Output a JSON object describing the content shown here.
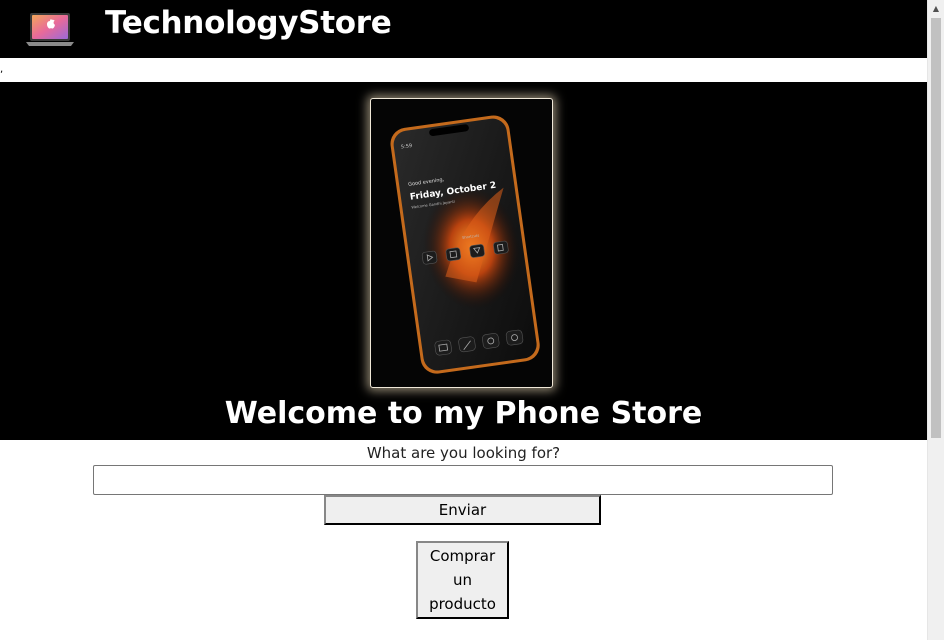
{
  "header": {
    "logo_icon": "laptop-logo-icon",
    "brand": "TechnologyStore"
  },
  "stray_text": ",",
  "hero": {
    "image_icon": "smartphone-product-image",
    "phone_screen": {
      "time": "5:59",
      "greeting": "Good evening,",
      "date": "Friday, October 2",
      "sub": "Welcome Gandhi Jayanti",
      "widget_label": "Shortcuts"
    },
    "title": "Welcome to my Phone Store"
  },
  "search": {
    "label": "What are you looking for?",
    "value": "",
    "placeholder": "",
    "submit_label": "Enviar"
  },
  "buy_button_label": "Comprar un producto",
  "colors": {
    "header_bg": "#000000",
    "hero_bg": "#000000",
    "accent_orange": "#e07a1f",
    "button_bg": "#efefef"
  }
}
